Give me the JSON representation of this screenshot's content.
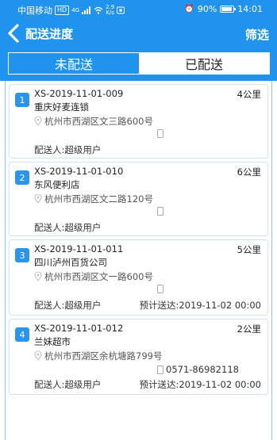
{
  "statusbar": {
    "carrier": "中国移动",
    "hd": "HD",
    "network": "4G",
    "speed_value": "2.9",
    "speed_unit": "K/s",
    "alarm": "⏰",
    "battery": "90%",
    "time": "14:01"
  },
  "nav": {
    "title": "配送进度",
    "filter": "筛选"
  },
  "tabs": {
    "undelivered": "未配送",
    "delivered": "已配送"
  },
  "orders": [
    {
      "index": "1",
      "order_no": "XS-2019-11-01-009",
      "distance": "4公里",
      "customer": "重庆好麦连锁",
      "address": "杭州市西湖区文三路600号",
      "phone": "",
      "courier": "配送人:超级用户",
      "eta": ""
    },
    {
      "index": "2",
      "order_no": "XS-2019-11-01-010",
      "distance": "6公里",
      "customer": "东风便利店",
      "address": "杭州市西湖区文二路120号",
      "phone": "",
      "courier": "配送人:超级用户",
      "eta": ""
    },
    {
      "index": "3",
      "order_no": "XS-2019-11-01-011",
      "distance": "5公里",
      "customer": "四川泸州百货公司",
      "address": "杭州市西湖区文一路600号",
      "phone": "",
      "courier": "配送人:超级用户",
      "eta": "预计送达:2019-11-02 00:00"
    },
    {
      "index": "4",
      "order_no": "XS-2019-11-01-012",
      "distance": "2公里",
      "customer": "兰妹超市",
      "address": "杭州市西湖区余杭塘路799号",
      "phone": "0571-86982118",
      "courier": "配送人:超级用户",
      "eta": "预计送达:2019-11-02 00:00"
    }
  ],
  "colors": {
    "primary": "#1f93ee",
    "badge": "#2a95ec"
  }
}
